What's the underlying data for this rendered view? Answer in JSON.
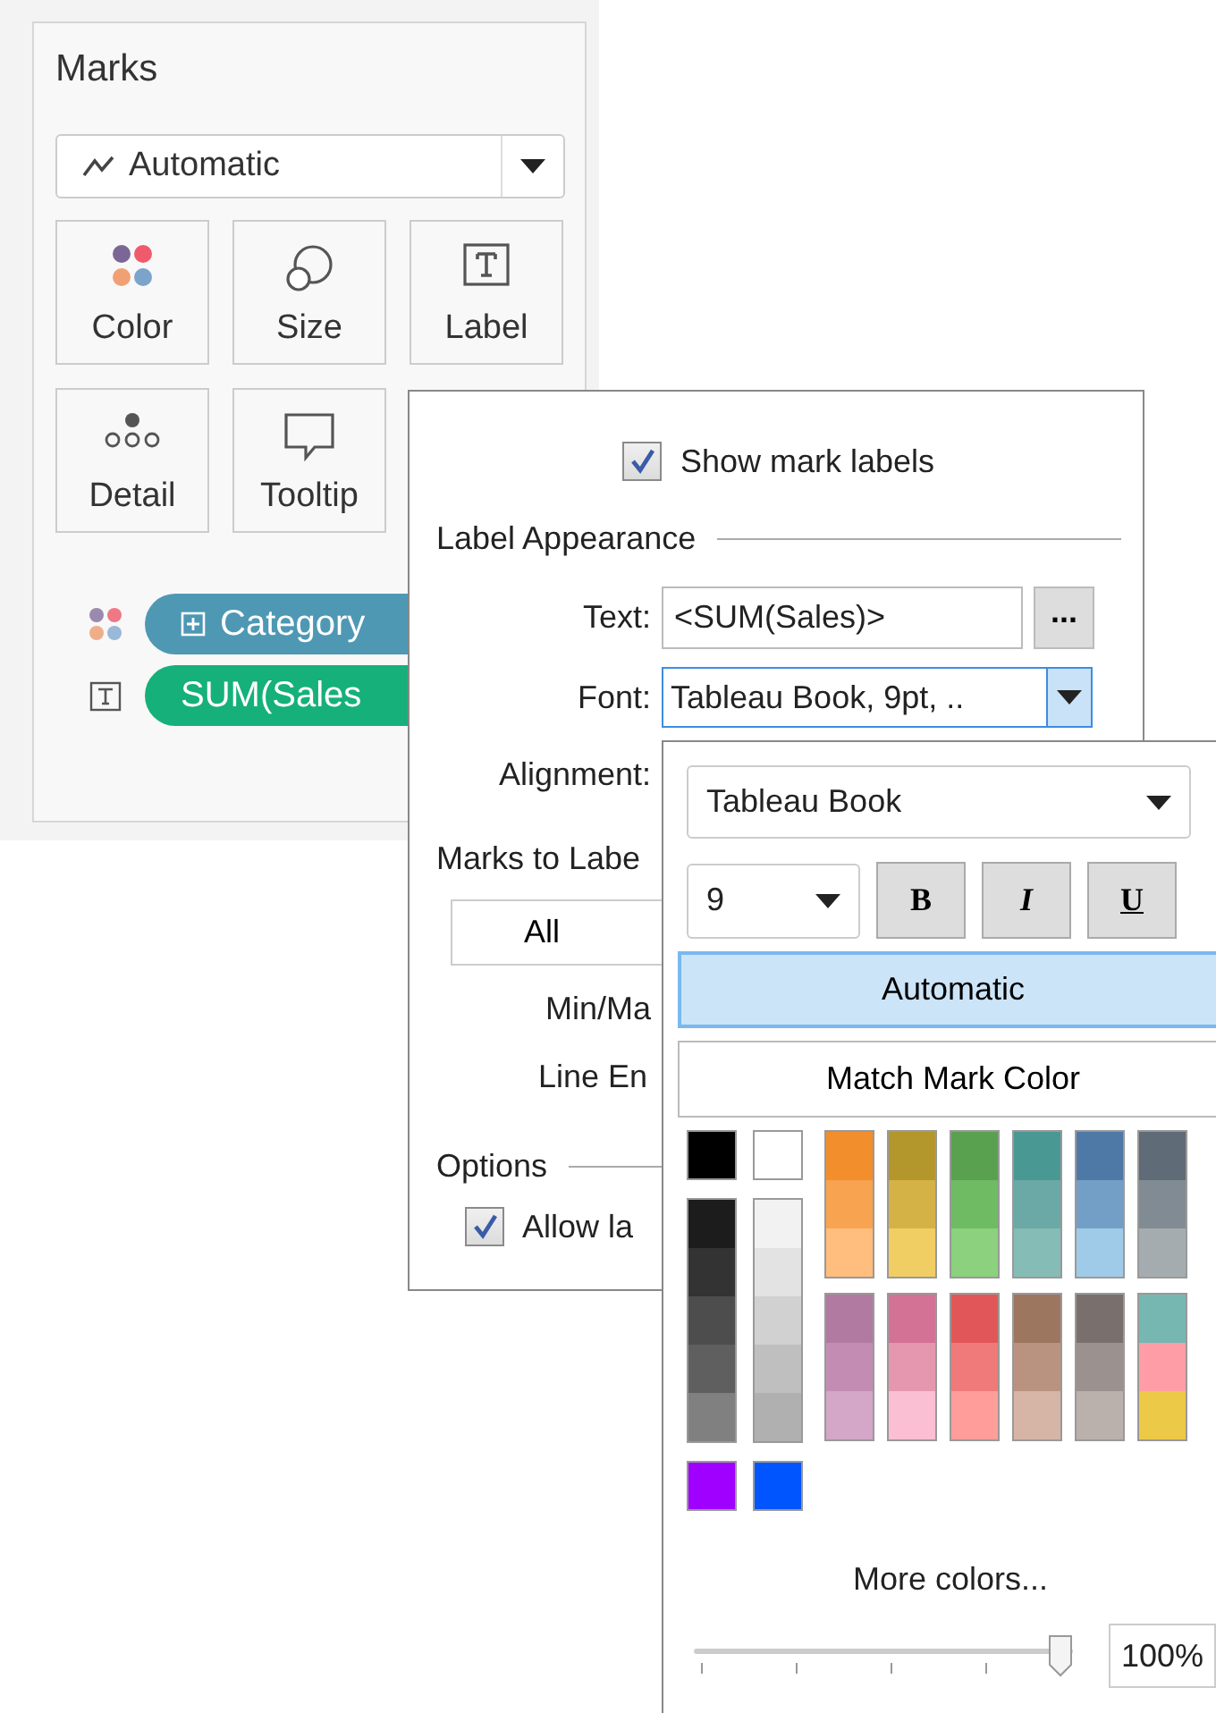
{
  "marks": {
    "title": "Marks",
    "mark_type": "Automatic",
    "cards": [
      {
        "label": "Color",
        "kind": "color"
      },
      {
        "label": "Size",
        "kind": "size"
      },
      {
        "label": "Label",
        "kind": "label"
      },
      {
        "label": "Detail",
        "kind": "detail"
      },
      {
        "label": "Tooltip",
        "kind": "tooltip"
      }
    ],
    "pills": [
      {
        "label": "Category",
        "kind": "color",
        "color": "#4e98b4",
        "expandable": true
      },
      {
        "label": "SUM(Sales",
        "kind": "label",
        "color": "#16b07b",
        "expandable": false
      }
    ]
  },
  "label_popup": {
    "show_labels": {
      "label": "Show mark labels",
      "checked": true
    },
    "appearance_title": "Label Appearance",
    "text_label": "Text:",
    "text_value": "<SUM(Sales)>",
    "more_button": "...",
    "font_label": "Font:",
    "font_value": "Tableau Book, 9pt, ..",
    "alignment_label": "Alignment:",
    "marks_to_label_title": "Marks to Labe",
    "marks_options": [
      {
        "label": "All",
        "kind": "button"
      },
      {
        "label": "Min/Ma",
        "kind": "radio"
      },
      {
        "label": "Line En",
        "kind": "radio"
      }
    ],
    "options_title": "Options",
    "allow": {
      "label": "Allow la",
      "checked": true
    }
  },
  "font_popup": {
    "family": "Tableau Book",
    "size": "9",
    "styles": [
      {
        "label": "B",
        "kind": "bold"
      },
      {
        "label": "I",
        "kind": "italic"
      },
      {
        "label": "U",
        "kind": "underline"
      }
    ],
    "color_modes": [
      {
        "label": "Automatic",
        "selected": true
      },
      {
        "label": "Match Mark Color",
        "selected": false
      }
    ],
    "basic_colors": [
      {
        "color": "#000000"
      },
      {
        "color": "#ffffff"
      }
    ],
    "gray_columns": [
      {
        "swatches": [
          {
            "color": "#1c1c1c"
          },
          {
            "color": "#333333"
          },
          {
            "color": "#4d4d4d"
          },
          {
            "color": "#5f5f5f"
          },
          {
            "color": "#808080"
          }
        ]
      },
      {
        "swatches": [
          {
            "color": "#f2f2f2"
          },
          {
            "color": "#e3e3e3"
          },
          {
            "color": "#d1d1d1"
          },
          {
            "color": "#bfbfbf"
          },
          {
            "color": "#b0b0b0"
          }
        ]
      }
    ],
    "palette_rows": [
      {
        "columns": [
          {
            "swatches": [
              {
                "color": "#f28e2b"
              },
              {
                "color": "#f8a34f"
              },
              {
                "color": "#ffbe7d"
              }
            ]
          },
          {
            "swatches": [
              {
                "color": "#b4972c"
              },
              {
                "color": "#d4b246"
              },
              {
                "color": "#f1ce63"
              }
            ]
          },
          {
            "swatches": [
              {
                "color": "#59a14f"
              },
              {
                "color": "#6fbb64"
              },
              {
                "color": "#8cd17d"
              }
            ]
          },
          {
            "swatches": [
              {
                "color": "#499894"
              },
              {
                "color": "#6aa9a6"
              },
              {
                "color": "#86bcb6"
              }
            ]
          },
          {
            "swatches": [
              {
                "color": "#4e79a7"
              },
              {
                "color": "#739fc7"
              },
              {
                "color": "#a0cbe8"
              }
            ]
          },
          {
            "swatches": [
              {
                "color": "#5f6b76"
              },
              {
                "color": "#818b93"
              },
              {
                "color": "#a5acaf"
              }
            ]
          }
        ]
      },
      {
        "columns": [
          {
            "swatches": [
              {
                "color": "#b07aa1"
              },
              {
                "color": "#c38db3"
              },
              {
                "color": "#d4a6c8"
              }
            ]
          },
          {
            "swatches": [
              {
                "color": "#d37295"
              },
              {
                "color": "#e597b0"
              },
              {
                "color": "#fabfd2"
              }
            ]
          },
          {
            "swatches": [
              {
                "color": "#e15759"
              },
              {
                "color": "#f07a7a"
              },
              {
                "color": "#ff9d9a"
              }
            ]
          },
          {
            "swatches": [
              {
                "color": "#9d7660"
              },
              {
                "color": "#b9937f"
              },
              {
                "color": "#d7b5a6"
              }
            ]
          },
          {
            "swatches": [
              {
                "color": "#79706e"
              },
              {
                "color": "#9b918f"
              },
              {
                "color": "#bab0ac"
              }
            ]
          },
          {
            "swatches": [
              {
                "color": "#76b7b2"
              },
              {
                "color": "#ff9da7"
              },
              {
                "color": "#edc948"
              }
            ]
          }
        ]
      }
    ],
    "extra_colors": [
      {
        "color": "#a000ff"
      },
      {
        "color": "#0055ff"
      }
    ],
    "more_colors": "More colors...",
    "opacity": {
      "level": 1,
      "reading": "100%"
    }
  }
}
